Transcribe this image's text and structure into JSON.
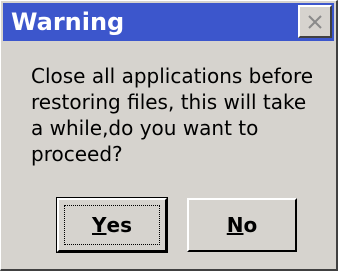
{
  "dialog": {
    "title": "Warning",
    "message": "Close all applications before\nrestoring files, this will take\na while,do you want to\nproceed?",
    "close_icon": "close-icon"
  },
  "buttons": {
    "yes_mnemonic": "Y",
    "yes_rest": "es",
    "no_mnemonic": "N",
    "no_rest": "o"
  },
  "colors": {
    "titlebar": "#3c56cc",
    "face": "#d6d3ce"
  }
}
